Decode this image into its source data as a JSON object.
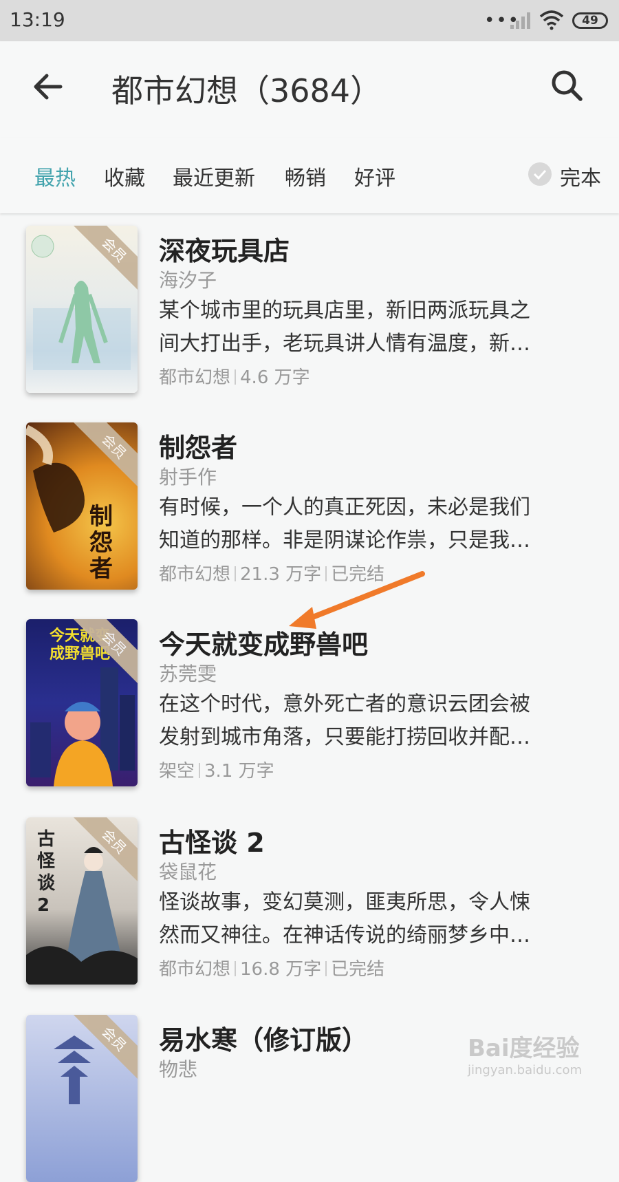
{
  "status_bar": {
    "time": "13:19",
    "battery": "49",
    "dots": "•••"
  },
  "header": {
    "title": "都市幻想（3684）",
    "back_icon": "arrow-left-icon",
    "search_icon": "search-icon"
  },
  "filters": {
    "tabs": [
      "最热",
      "收藏",
      "最近更新",
      "畅销",
      "好评"
    ],
    "active_tab": "最热",
    "finished_label": "完本",
    "accent_color": "#42a3ad"
  },
  "books": [
    {
      "title": "深夜玩具店",
      "author": "海汐子",
      "desc_line1": "某个城市里的玩具店里，新旧两派玩具之",
      "desc_line2": "间大打出手，老玩具讲人情有温度，新…",
      "genre": "都市幻想",
      "words": "4.6 万字",
      "status": "",
      "badge": "会员"
    },
    {
      "title": "制怨者",
      "author": "射手作",
      "desc_line1": "有时候，一个人的真正死因，未必是我们",
      "desc_line2": "知道的那样。非是阴谋论作祟，只是我…",
      "genre": "都市幻想",
      "words": "21.3 万字",
      "status": "已完结",
      "badge": "会员",
      "cover_text": "制怨者"
    },
    {
      "title": "今天就变成野兽吧",
      "author": "苏莞雯",
      "desc_line1": "在这个时代，意外死亡者的意识云团会被",
      "desc_line2": "发射到城市角落，只要能打捞回收并配…",
      "genre": "架空",
      "words": "3.1 万字",
      "status": "",
      "badge": "会员",
      "cover_text": "今天就变成野兽吧"
    },
    {
      "title": "古怪谈 2",
      "author": "袋鼠花",
      "desc_line1": "怪谈故事，变幻莫测，匪夷所思，令人悚",
      "desc_line2": "然而又神往。在神话传说的绮丽梦乡中…",
      "genre": "都市幻想",
      "words": "16.8 万字",
      "status": "已完结",
      "badge": "会员",
      "cover_text": "古怪谈2"
    },
    {
      "title": "易水寒（修订版）",
      "author": "物悲",
      "badge": "会员"
    }
  ],
  "watermark": {
    "brand": "Bai度经验",
    "url": "jingyan.baidu.com"
  }
}
